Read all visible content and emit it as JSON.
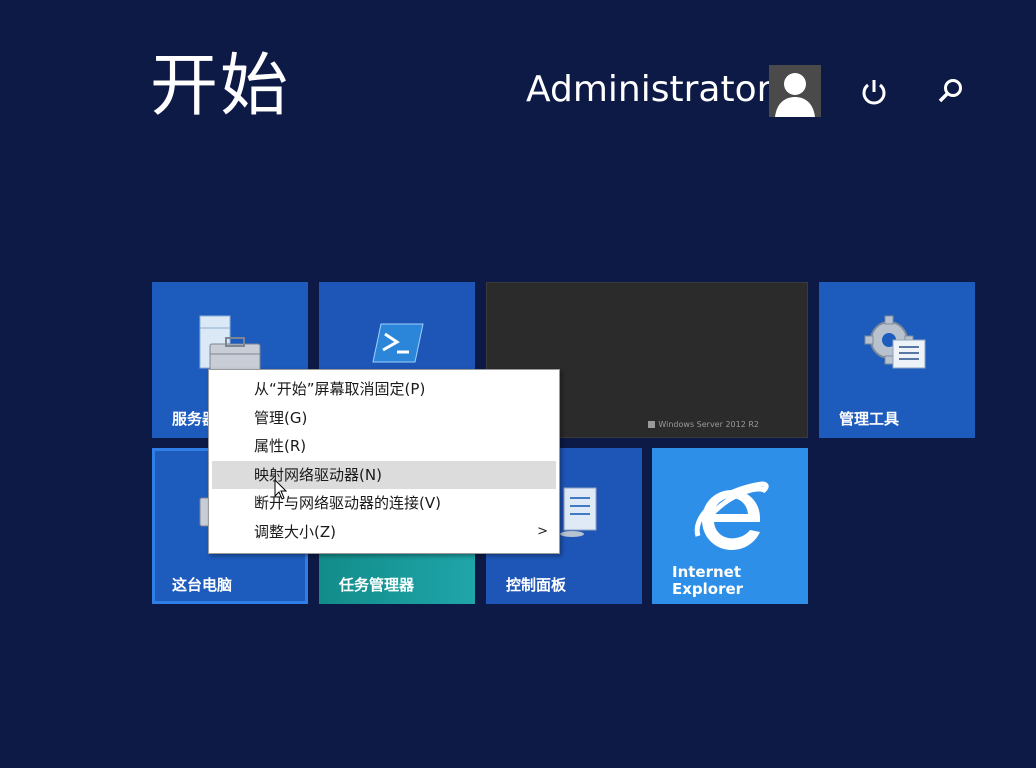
{
  "header": {
    "title": "开始",
    "user_name": "Administrator"
  },
  "tiles": [
    {
      "id": "server-manager",
      "label": "服务器"
    },
    {
      "id": "powershell",
      "label": ""
    },
    {
      "id": "desktop",
      "label": "",
      "watermark": "Windows Server 2012 R2"
    },
    {
      "id": "admin-tools",
      "label": "管理工具"
    },
    {
      "id": "this-pc",
      "label": "这台电脑"
    },
    {
      "id": "task-manager",
      "label": "任务管理器"
    },
    {
      "id": "control-panel",
      "label": "控制面板"
    },
    {
      "id": "internet-explorer",
      "label_line1": "Internet",
      "label_line2": "Explorer"
    }
  ],
  "context_menu": {
    "items": [
      {
        "label": "从“开始”屏幕取消固定(P)"
      },
      {
        "label": "管理(G)"
      },
      {
        "label": "属性(R)"
      },
      {
        "label": "映射网络驱动器(N)",
        "highlighted": true
      },
      {
        "label": "断开与网络驱动器的连接(V)"
      },
      {
        "label": "调整大小(Z)",
        "submenu_arrow": ">"
      }
    ]
  },
  "colors": {
    "background": "#0c1a45",
    "tile_blue": "#1d5bbd",
    "tile_teal": "#1fa5a9",
    "tile_ie": "#2e8fe8"
  }
}
